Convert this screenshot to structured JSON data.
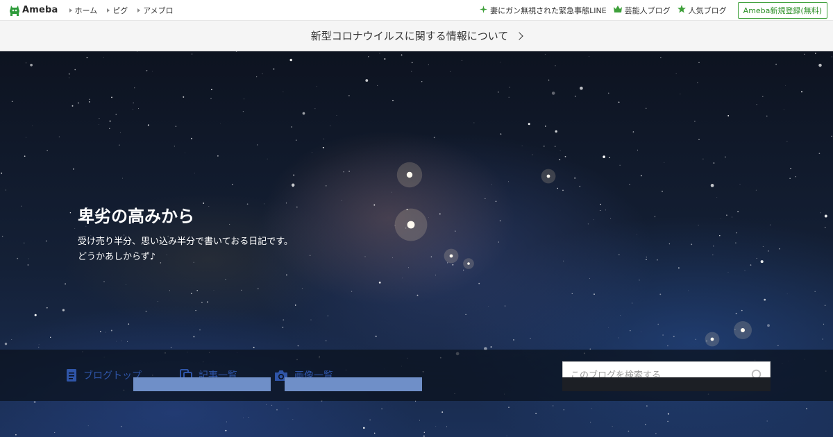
{
  "header": {
    "logo_text": "Ameba",
    "nav_left": [
      "ホーム",
      "ピグ",
      "アメブロ"
    ],
    "nav_right": [
      {
        "label": "妻にガン無視された緊急事態LINE",
        "icon": "sparkle-icon"
      },
      {
        "label": "芸能人ブログ",
        "icon": "crown-icon"
      },
      {
        "label": "人気ブログ",
        "icon": "star-icon"
      }
    ],
    "register_label": "Ameba新規登録(無料)"
  },
  "notice": {
    "text": "新型コロナウイルスに関する情報について"
  },
  "hero": {
    "title": "卑劣の高みから",
    "description": "受け売り半分、思い込み半分で書いておる日記です。\nどうかあしからず♪"
  },
  "blognav": {
    "items": [
      {
        "label": "ブログトップ",
        "icon": "document-icon"
      },
      {
        "label": "記事一覧",
        "icon": "copy-icon"
      },
      {
        "label": "画像一覧",
        "icon": "camera-icon"
      }
    ],
    "search_placeholder": "このブログを検索する"
  },
  "colors": {
    "accent_green": "#3ea03a",
    "nav_blue": "#2f55a8",
    "header_bg": "#ffffff",
    "notice_bg": "#f5f5f5"
  }
}
